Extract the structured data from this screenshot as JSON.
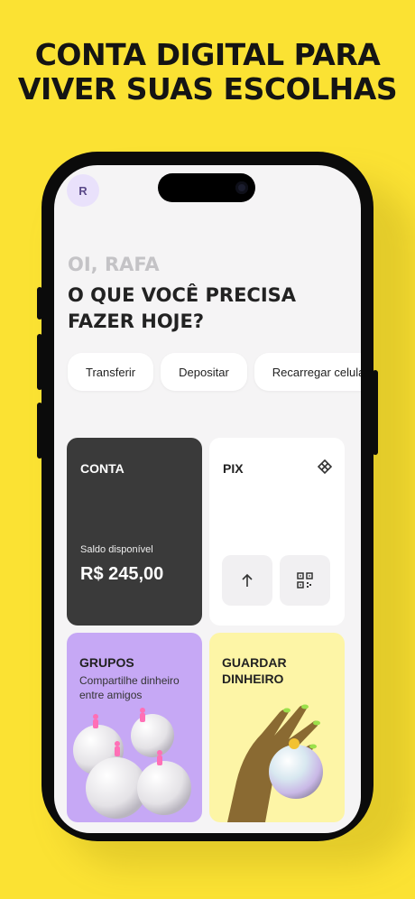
{
  "headline": {
    "line1": "CONTA DIGITAL PARA",
    "line2": "VIVER SUAS ESCOLHAS"
  },
  "profile": {
    "initial": "R"
  },
  "greeting": "OI, RAFA",
  "question": {
    "line1": "O QUE VOCÊ PRECISA",
    "line2": "FAZER HOJE?"
  },
  "quick_actions": [
    "Transferir",
    "Depositar",
    "Recarregar celular"
  ],
  "cards": {
    "conta": {
      "title": "CONTA",
      "balance_label": "Saldo disponível",
      "balance": "R$ 245,00"
    },
    "pix": {
      "title": "PIX"
    },
    "grupos": {
      "title": "GRUPOS",
      "description": "Compartilhe dinheiro entre amigos"
    },
    "guardar": {
      "title_line1": "GUARDAR",
      "title_line2": "DINHEIRO"
    }
  },
  "colors": {
    "background": "#fbe233",
    "conta_card": "#3a3a3a",
    "grupos_card": "#c6a8f5",
    "guardar_card": "#fdf5a6"
  }
}
